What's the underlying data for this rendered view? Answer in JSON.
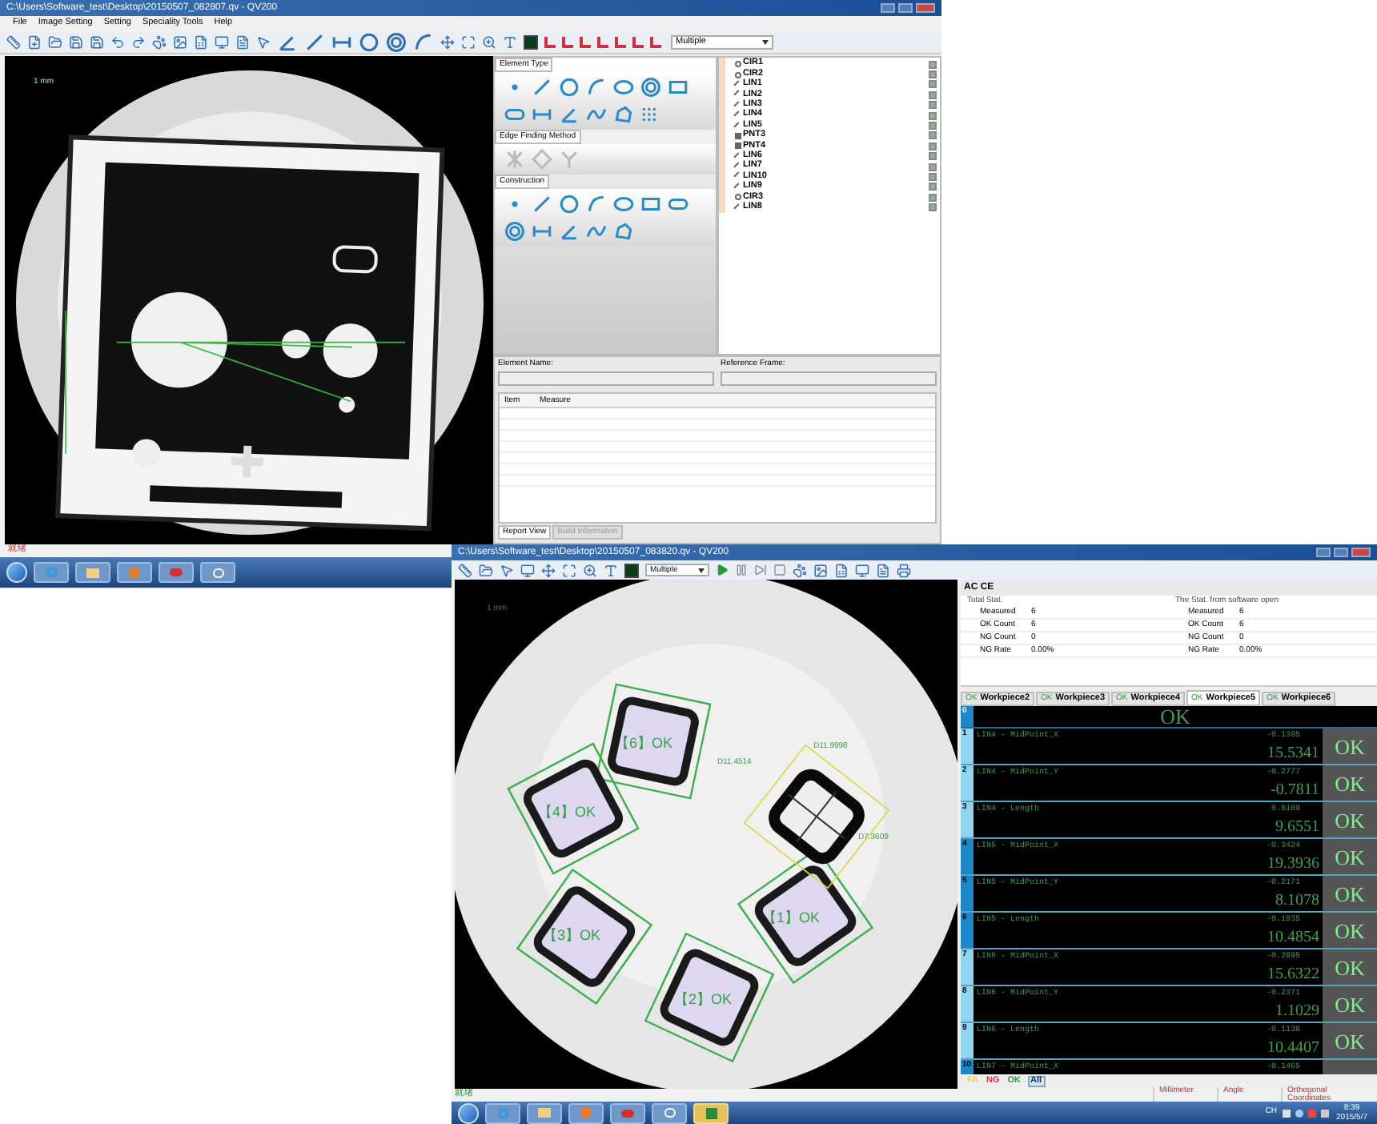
{
  "window_1": {
    "title": "C:\\Users\\Software_test\\Desktop\\20150507_082807.qv - QV200",
    "menu": [
      "File",
      "Image Setting",
      "Setting",
      "Speciality Tools",
      "Help"
    ],
    "mode_dropdown": "Multiple",
    "scale_label": "1 mm",
    "groups": [
      "Element Type",
      "Edge Finding Method",
      "Construction"
    ],
    "elements": [
      {
        "name": "CIR1",
        "kind": "circle",
        "checked": true
      },
      {
        "name": "CIR2",
        "kind": "circle",
        "checked": true
      },
      {
        "name": "LIN1",
        "kind": "line",
        "checked": true
      },
      {
        "name": "LIN2",
        "kind": "line",
        "checked": true
      },
      {
        "name": "LIN3",
        "kind": "line",
        "checked": true
      },
      {
        "name": "LIN4",
        "kind": "line",
        "checked": true
      },
      {
        "name": "LIN5",
        "kind": "line",
        "checked": true
      },
      {
        "name": "PNT3",
        "kind": "point",
        "checked": true
      },
      {
        "name": "PNT4",
        "kind": "point",
        "checked": true
      },
      {
        "name": "LIN6",
        "kind": "line",
        "checked": true
      },
      {
        "name": "LIN7",
        "kind": "line",
        "checked": true
      },
      {
        "name": "LIN10",
        "kind": "line",
        "checked": true
      },
      {
        "name": "LIN9",
        "kind": "line",
        "checked": true
      },
      {
        "name": "CIR3",
        "kind": "circle",
        "checked": true
      },
      {
        "name": "LIN8",
        "kind": "line",
        "checked": true
      }
    ],
    "element_name_label": "Element Name:",
    "reference_frame_label": "Reference Frame:",
    "table_columns": [
      "Item",
      "Measure"
    ],
    "tabs": [
      {
        "label": "Report View",
        "selected": true
      },
      {
        "label": "Build Information",
        "selected": false
      }
    ],
    "status": "就绪"
  },
  "window_2": {
    "title": "C:\\Users\\Software_test\\Desktop\\20150507_083820.qv - QV200",
    "mode_dropdown": "Multiple",
    "scale_label": "1 mm",
    "overlay_labels": [
      "【6】OK",
      "【4】OK",
      "【3】OK",
      "【2】OK",
      "【1】OK",
      "D11.4514",
      "D11.9998",
      "D7.3609"
    ],
    "stats_header": "AC CE",
    "stat_groups": [
      {
        "title": "Total Stat.",
        "rows": [
          [
            "Measured",
            "6"
          ],
          [
            "OK Count",
            "6"
          ],
          [
            "NG Count",
            "0"
          ],
          [
            "NG Rate",
            "0.00%"
          ]
        ]
      },
      {
        "title": "The Stat. from software open",
        "rows": [
          [
            "Measured",
            "6"
          ],
          [
            "OK Count",
            "6"
          ],
          [
            "NG Count",
            "0"
          ],
          [
            "NG Rate",
            "0.00%"
          ]
        ]
      }
    ],
    "tabs": [
      {
        "badge": "OK",
        "label": "Workpiece2",
        "selected": false
      },
      {
        "badge": "OK",
        "label": "Workpiece3",
        "selected": false
      },
      {
        "badge": "OK",
        "label": "Workpiece4",
        "selected": false
      },
      {
        "badge": "OK",
        "label": "Workpiece5",
        "selected": true
      },
      {
        "badge": "OK",
        "label": "Workpiece6",
        "selected": false
      }
    ],
    "summary": {
      "index": "0",
      "result": "OK"
    },
    "rows": [
      {
        "index": "1",
        "label": "LIN4 - MidPoint_X",
        "deviation": "-0.1305",
        "value": "15.5341",
        "result": "OK",
        "color": "#8fd3ee"
      },
      {
        "index": "2",
        "label": "LIN4 - MidPoint_Y",
        "deviation": "-0.2777",
        "value": "-0.7811",
        "result": "OK",
        "color": "#8fd3ee"
      },
      {
        "index": "3",
        "label": "LIN4 - Length",
        "deviation": "0.0109",
        "value": "9.6551",
        "result": "OK",
        "color": "#8fd3ee"
      },
      {
        "index": "4",
        "label": "LIN5 - MidPoint_X",
        "deviation": "-0.3424",
        "value": "19.3936",
        "result": "OK",
        "color": "#1d86c8"
      },
      {
        "index": "5",
        "label": "LIN5 - MidPoint_Y",
        "deviation": "-0.2171",
        "value": "8.1078",
        "result": "OK",
        "color": "#1d86c8"
      },
      {
        "index": "6",
        "label": "LIN5 - Length",
        "deviation": "-0.1935",
        "value": "10.4854",
        "result": "OK",
        "color": "#1d86c8"
      },
      {
        "index": "7",
        "label": "LIN6 - MidPoint_X",
        "deviation": "-0.2895",
        "value": "15.6322",
        "result": "OK",
        "color": "#8fd3ee"
      },
      {
        "index": "8",
        "label": "LIN6 - MidPoint_Y",
        "deviation": "-0.2371",
        "value": "1.1029",
        "result": "OK",
        "color": "#8fd3ee"
      },
      {
        "index": "9",
        "label": "LIN6 - Length",
        "deviation": "-0.1138",
        "value": "10.4407",
        "result": "OK",
        "color": "#8fd3ee"
      },
      {
        "index": "10",
        "label": "LIN7 - MidPoint_X",
        "deviation": "-0.1465",
        "color": "#1d86c8"
      }
    ],
    "filters": [
      {
        "label": "FA",
        "selected": false,
        "color": "#e8d84a"
      },
      {
        "label": "NG",
        "selected": false,
        "color": "#e0304a"
      },
      {
        "label": "OK",
        "selected": false,
        "color": "#2f9a3a"
      },
      {
        "label": "All",
        "selected": true,
        "color": "#1a2a5a"
      }
    ],
    "status": "就绪",
    "status_fields": [
      "Millimeter",
      "Angle",
      "Orthogonal Coordinates"
    ],
    "tray": {
      "language": "CH",
      "time": "8:39",
      "date": "2015/5/7"
    }
  }
}
